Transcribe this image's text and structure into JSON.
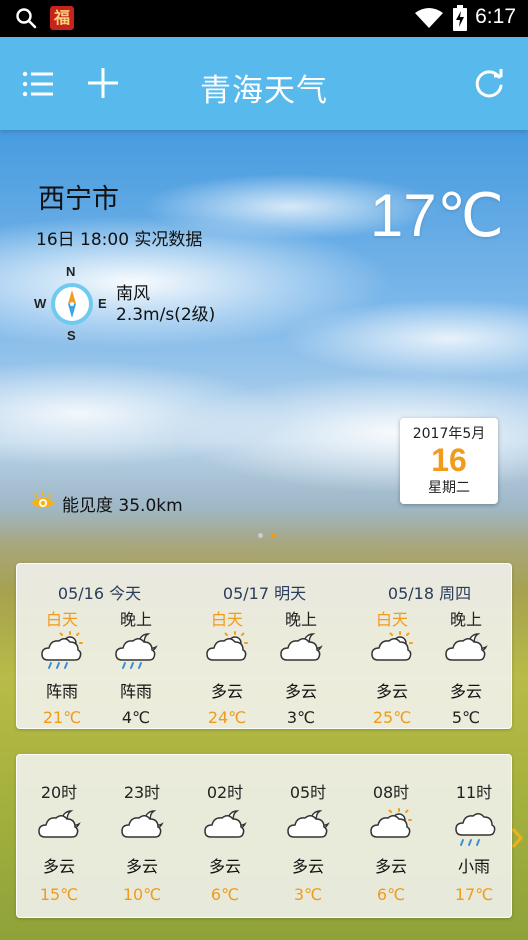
{
  "status_bar": {
    "time": "6:17",
    "app_badge": "福"
  },
  "app_bar": {
    "title": "青海天气"
  },
  "current": {
    "city": "西宁市",
    "observed": "16日 18:00 实况数据",
    "temperature": "17℃",
    "wind_direction": "南风",
    "wind_speed": "2.3m/s(2级)",
    "compass": {
      "n": "N",
      "s": "S",
      "w": "W",
      "e": "E"
    },
    "visibility": "能见度 35.0km"
  },
  "date_card": {
    "year_month": "2017年5月",
    "day": "16",
    "weekday": "星期二"
  },
  "daily": [
    {
      "head": "05/16 今天",
      "day_label": "白天",
      "night_label": "晚上",
      "day_icon": "shower-icon",
      "night_icon": "night-shower-icon",
      "day_cond": "阵雨",
      "night_cond": "阵雨",
      "day_temp": "21℃",
      "night_temp": "4℃"
    },
    {
      "head": "05/17 明天",
      "day_label": "白天",
      "night_label": "晚上",
      "day_icon": "partly-cloudy-icon",
      "night_icon": "night-cloudy-icon",
      "day_cond": "多云",
      "night_cond": "多云",
      "day_temp": "24℃",
      "night_temp": "3℃"
    },
    {
      "head": "05/18 周四",
      "day_label": "白天",
      "night_label": "晚上",
      "day_icon": "partly-cloudy-icon",
      "night_icon": "night-cloudy-icon",
      "day_cond": "多云",
      "night_cond": "多云",
      "day_temp": "25℃",
      "night_temp": "5℃"
    }
  ],
  "hourly": [
    {
      "hour": "20时",
      "icon": "night-cloudy-icon",
      "cond": "多云",
      "temp": "15℃"
    },
    {
      "hour": "23时",
      "icon": "night-cloudy-icon",
      "cond": "多云",
      "temp": "10℃"
    },
    {
      "hour": "02时",
      "icon": "night-cloudy-icon",
      "cond": "多云",
      "temp": "6℃"
    },
    {
      "hour": "05时",
      "icon": "night-cloudy-icon",
      "cond": "多云",
      "temp": "3℃"
    },
    {
      "hour": "08时",
      "icon": "partly-cloudy-icon",
      "cond": "多云",
      "temp": "6℃"
    },
    {
      "hour": "11时",
      "icon": "light-rain-icon",
      "cond": "小雨",
      "temp": "17℃"
    }
  ],
  "colors": {
    "accent": "#f29a1a",
    "app_bar": "#58baec",
    "card_text": "#2a3d5a"
  }
}
